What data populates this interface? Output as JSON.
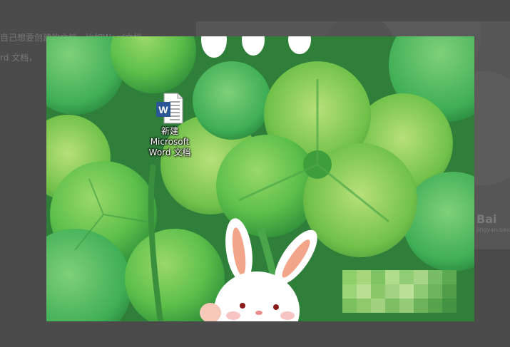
{
  "background_page": {
    "line1": "自己想要创建的文档，比如Word文档",
    "line2": "rd 文档，",
    "logo_text": "Bai",
    "logo_sub": "jingyan.baidu.com"
  },
  "desktop": {
    "wallpaper": "four-leaf-clover-bunny",
    "accent_green": "#4caf50",
    "icons": [
      {
        "name": "word-document-icon",
        "label_line1": "新建",
        "label_line2": "Microsoft",
        "label_line3": "Word 文档"
      }
    ]
  }
}
